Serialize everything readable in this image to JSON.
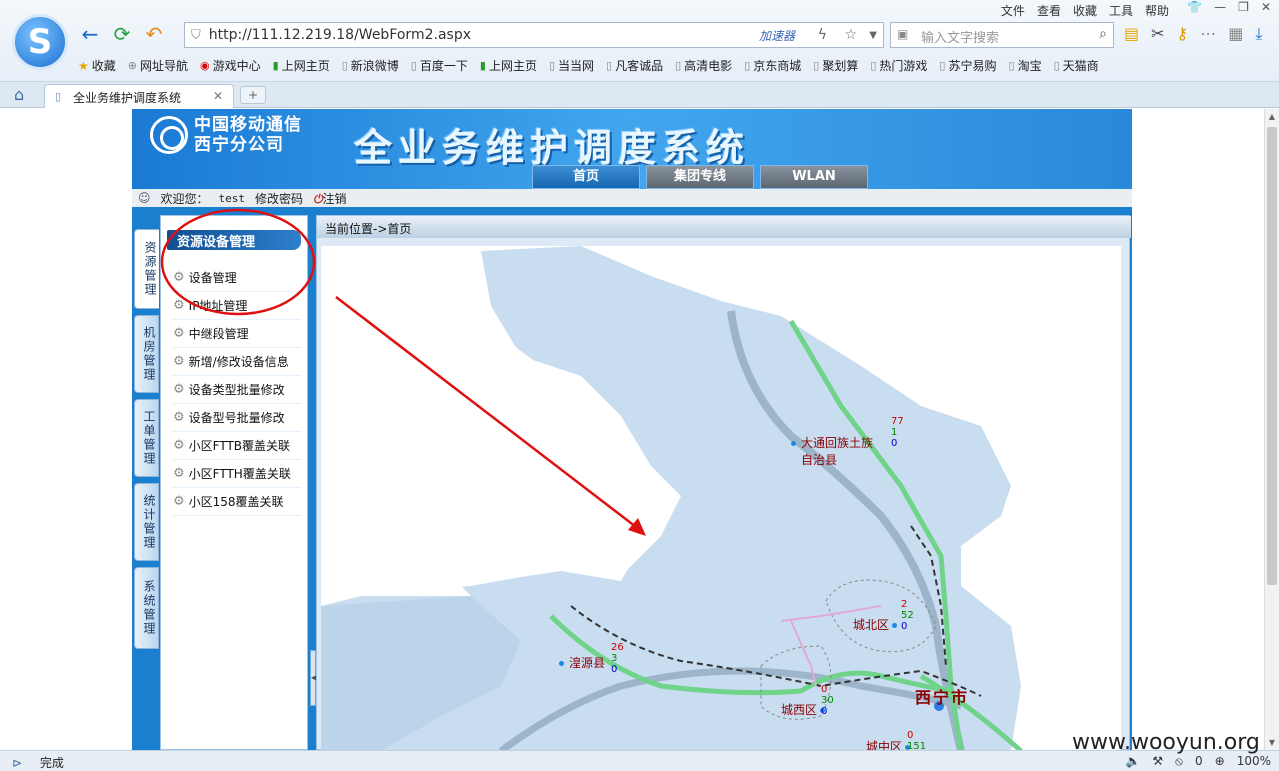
{
  "browser": {
    "menu": [
      "文件",
      "查看",
      "收藏",
      "工具",
      "帮助"
    ],
    "url": "http://111.12.219.18/WebForm2.aspx",
    "accelerator": "加速器",
    "search_placeholder": "输入文字搜索",
    "bookmarks": [
      "收藏",
      "网址导航",
      "游戏中心",
      "上网主页",
      "新浪微博",
      "百度一下",
      "上网主页",
      "当当网",
      "凡客诚品",
      "高清电影",
      "京东商城",
      "聚划算",
      "热门游戏",
      "苏宁易购",
      "淘宝",
      "天猫商"
    ],
    "tab_title": "全业务维护调度系统",
    "status": "完成",
    "status_right": [
      "0",
      "100%"
    ]
  },
  "page": {
    "brand_line1": "中国移动通信",
    "brand_line2": "西宁分公司",
    "system_title": "全业务维护调度系统",
    "topnav": [
      "首页",
      "集团专线",
      "WLAN"
    ],
    "welcome_label": "欢迎您：",
    "username": "test",
    "change_password": "修改密码",
    "logout": "注销",
    "side_tabs": [
      "资源管理",
      "机房管理",
      "工单管理",
      "统计管理",
      "系统管理"
    ],
    "menu_header": "资源设备管理",
    "menu_items": [
      "设备管理",
      "IP地址管理",
      "中继段管理",
      "新增/修改设备信息",
      "设备类型批量修改",
      "设备型号批量修改",
      "小区FTTB覆盖关联",
      "小区FTTH覆盖关联",
      "小区158覆盖关联"
    ],
    "breadcrumb": "当前位置->首页"
  },
  "map": {
    "regions": [
      {
        "name": "大通回族土族",
        "name2": "自治县",
        "stats": [
          "77",
          "1",
          "0"
        ]
      },
      {
        "name": "城北区",
        "stats": [
          "2",
          "52",
          "0"
        ]
      },
      {
        "name": "湟源县",
        "stats": [
          "26",
          "3",
          "0"
        ]
      },
      {
        "name": "城西区",
        "stats": [
          "0",
          "30",
          "0"
        ]
      },
      {
        "name": "城中区",
        "stats": [
          "0",
          "151"
        ]
      }
    ],
    "city": "西宁市"
  },
  "watermark": "www.wooyun.org"
}
